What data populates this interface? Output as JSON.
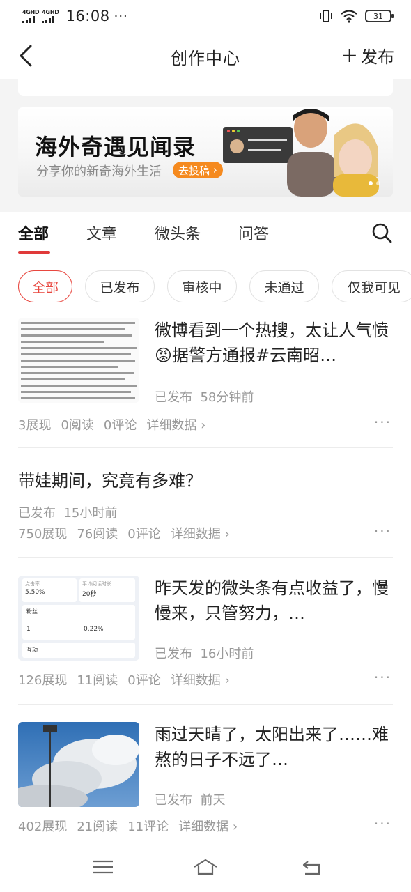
{
  "status_bar": {
    "signal1": "4GHD",
    "signal2": "4GHD",
    "time": "16:08",
    "dots": "···",
    "battery": "31"
  },
  "nav": {
    "title": "创作中心",
    "publish": "发布"
  },
  "banner": {
    "title": "海外奇遇见闻录",
    "subtitle": "分享你的新奇海外生活",
    "button": "去投稿"
  },
  "tabs": [
    "全部",
    "文章",
    "微头条",
    "问答"
  ],
  "filters": [
    "全部",
    "已发布",
    "审核中",
    "未通过",
    "仅我可见"
  ],
  "posts": [
    {
      "title": "微博看到一个热搜，太让人气愤😡据警方通报#云南昭…",
      "status": "已发布",
      "time": "58分钟前",
      "views": "3展现",
      "reads": "0阅读",
      "comments": "0评论",
      "detail": "详细数据"
    },
    {
      "title": "带娃期间，究竟有多难？",
      "status": "已发布",
      "time": "15小时前",
      "views": "750展现",
      "reads": "76阅读",
      "comments": "0评论",
      "detail": "详细数据"
    },
    {
      "title": "昨天发的微头条有点收益了，慢慢来，只管努力，…",
      "status": "已发布",
      "time": "16小时前",
      "views": "126展现",
      "reads": "11阅读",
      "comments": "0评论",
      "detail": "详细数据"
    },
    {
      "title": "雨过天晴了，太阳出来了……难熬的日子不远了…",
      "status": "已发布",
      "time": "前天",
      "views": "402展现",
      "reads": "21阅读",
      "comments": "11评论",
      "detail": "详细数据"
    }
  ],
  "more_label": "···",
  "thumb_stats": {
    "clickrate_label": "点击率",
    "clickrate_value": "5.50%",
    "duration_label": "平均阅读时长",
    "duration_value": "20秒",
    "fans_label": "粉丝",
    "fans_count": "1",
    "fans_rate": "0.22%",
    "interact_label": "互动"
  }
}
